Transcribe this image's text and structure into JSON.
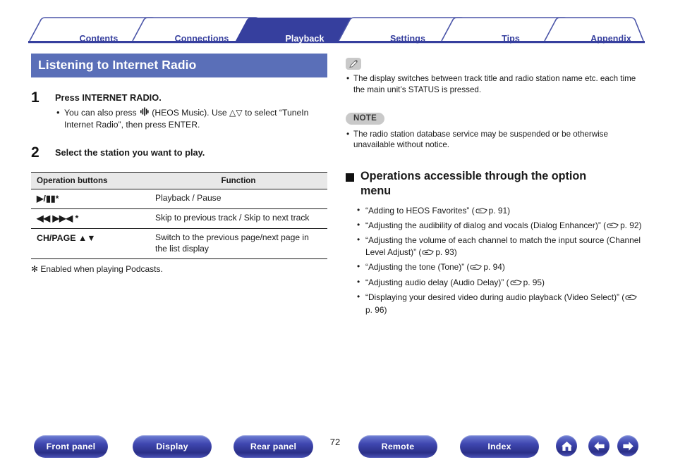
{
  "tabs": [
    {
      "label": "Contents",
      "active": false
    },
    {
      "label": "Connections",
      "active": false
    },
    {
      "label": "Playback",
      "active": true
    },
    {
      "label": "Settings",
      "active": false
    },
    {
      "label": "Tips",
      "active": false
    },
    {
      "label": "Appendix",
      "active": false
    }
  ],
  "page": {
    "title": "Listening to Internet Radio",
    "number": "72",
    "accent_tab_active": "#363f9e",
    "accent_title_bar": "#5a6fb8",
    "accent_button": "#2a2f87"
  },
  "steps": [
    {
      "number": "1",
      "title": "Press INTERNET RADIO.",
      "bullets_pre": "You can also press ",
      "bullets_post": " (HEOS Music). Use △▽ to select “TuneIn Internet Radio”, then press ENTER."
    },
    {
      "number": "2",
      "title": "Select the station you want to play."
    }
  ],
  "table": {
    "headers": [
      "Operation buttons",
      "Function"
    ],
    "rows": [
      {
        "button": "▶/▮▮*",
        "function": "Playback / Pause"
      },
      {
        "button": "◀◀ ▶▶◀ *",
        "function": "Skip to previous track / Skip to next track"
      },
      {
        "button": "CH/PAGE ▲▼",
        "function": "Switch to the previous page/next page in the list display"
      }
    ],
    "footnote": "✻ Enabled when playing Podcasts."
  },
  "tip": {
    "icon": "pencil-icon",
    "text": "The display switches between track title and radio station name etc. each time the main unit’s STATUS is pressed."
  },
  "note": {
    "badge": "NOTE",
    "text": "The radio station database service may be suspended or be otherwise unavailable without notice."
  },
  "options": {
    "heading": "Operations accessible through the option menu",
    "items": [
      {
        "text": "“Adding to HEOS Favorites” (",
        "page": "p. 91",
        "close": ")"
      },
      {
        "text": "“Adjusting the audibility of dialog and vocals (Dialog Enhancer)” (",
        "page": "p. 92",
        "close": ")"
      },
      {
        "text": "“Adjusting the volume of each channel to match the input source (Channel Level Adjust)” (",
        "page": "p. 93",
        "close": ")"
      },
      {
        "text": "“Adjusting the tone (Tone)” (",
        "page": "p. 94",
        "close": ")"
      },
      {
        "text": "“Adjusting audio delay (Audio Delay)” (",
        "page": "p. 95",
        "close": ")"
      },
      {
        "text": "“Displaying your desired video during audio playback (Video Select)” (",
        "page": "p. 96",
        "close": ")"
      }
    ]
  },
  "footer": {
    "buttons": [
      {
        "label": "Front panel"
      },
      {
        "label": "Display"
      },
      {
        "label": "Rear panel"
      },
      {
        "label": "Remote"
      },
      {
        "label": "Index"
      }
    ],
    "icons": [
      {
        "name": "home-icon"
      },
      {
        "name": "arrow-left-icon"
      },
      {
        "name": "arrow-right-icon"
      }
    ]
  }
}
